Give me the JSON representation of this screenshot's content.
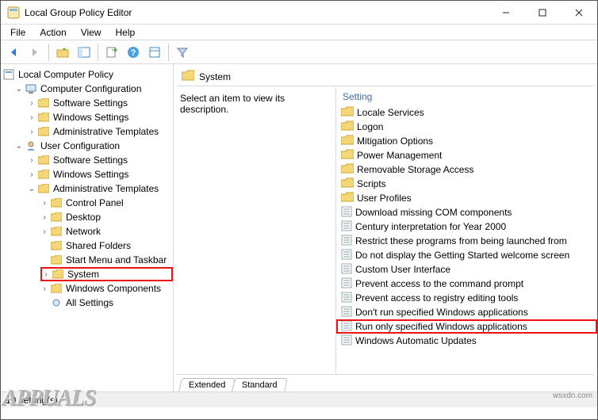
{
  "window": {
    "title": "Local Group Policy Editor"
  },
  "menubar": [
    "File",
    "Action",
    "View",
    "Help"
  ],
  "tree": {
    "root": "Local Computer Policy",
    "computer_config": "Computer Configuration",
    "cc_children": [
      "Software Settings",
      "Windows Settings",
      "Administrative Templates"
    ],
    "user_config": "User Configuration",
    "uc_software": "Software Settings",
    "uc_windows": "Windows Settings",
    "uc_admin": "Administrative Templates",
    "admin_children": [
      "Control Panel",
      "Desktop",
      "Network",
      "Shared Folders",
      "Start Menu and Taskbar",
      "System",
      "Windows Components",
      "All Settings"
    ]
  },
  "right": {
    "header": "System",
    "description_prompt": "Select an item to view its description.",
    "column_header": "Setting",
    "folders": [
      "Locale Services",
      "Logon",
      "Mitigation Options",
      "Power Management",
      "Removable Storage Access",
      "Scripts",
      "User Profiles"
    ],
    "settings": [
      "Download missing COM components",
      "Century interpretation for Year 2000",
      "Restrict these programs from being launched from",
      "Do not display the Getting Started welcome screen",
      "Custom User Interface",
      "Prevent access to the command prompt",
      "Prevent access to registry editing tools",
      "Don't run specified Windows applications",
      "Run only specified Windows applications",
      "Windows Automatic Updates"
    ],
    "highlighted_setting_index": 8
  },
  "tabs": [
    "Extended",
    "Standard"
  ],
  "statusbar": "10 setting(s)",
  "watermark_right": "wsxdn.com",
  "watermark_left": "APPUALS"
}
